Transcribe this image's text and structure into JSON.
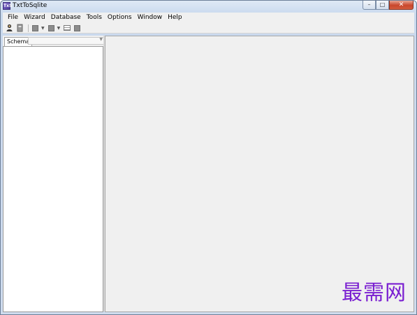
{
  "window": {
    "title": "TxtToSqlite",
    "app_icon_text": "TxS",
    "controls": {
      "minimize": "–",
      "maximize": "□",
      "close": "✕"
    }
  },
  "menubar": {
    "items": [
      {
        "label": "File"
      },
      {
        "label": "Wizard"
      },
      {
        "label": "Database"
      },
      {
        "label": "Tools"
      },
      {
        "label": "Options"
      },
      {
        "label": "Window"
      },
      {
        "label": "Help"
      }
    ]
  },
  "toolbar": {
    "buttons": [
      {
        "icon": "connect-icon"
      },
      {
        "icon": "disconnect-icon"
      },
      {
        "icon": "new-table-icon"
      },
      {
        "icon": "import-icon"
      },
      {
        "icon": "query-icon"
      },
      {
        "icon": "stop-icon"
      }
    ]
  },
  "schema_panel": {
    "tab_label": "Schema",
    "select_value": ""
  },
  "watermark": "最需网"
}
